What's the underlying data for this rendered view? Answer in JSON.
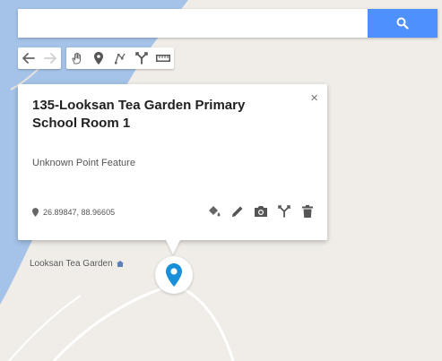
{
  "search": {
    "value": "",
    "placeholder": ""
  },
  "toolbar": {
    "groups": [
      [
        {
          "icon": "undo-icon"
        },
        {
          "icon": "redo-icon"
        }
      ],
      [
        {
          "icon": "hand-icon"
        },
        {
          "icon": "marker-icon"
        },
        {
          "icon": "draw-line-icon"
        },
        {
          "icon": "directions-icon"
        },
        {
          "icon": "ruler-icon"
        }
      ]
    ]
  },
  "info_card": {
    "title": "135-Looksan Tea Garden Primary School Room 1",
    "close": "×",
    "subtitle": "Unknown Point Feature",
    "coordinates": "26.89847, 88.96605",
    "actions": [
      "paint-bucket-icon",
      "pencil-icon",
      "camera-icon",
      "directions-icon",
      "trash-icon"
    ]
  },
  "map": {
    "place_label": "Looksan Tea Garden",
    "colors": {
      "land": "#f0ede8",
      "water": "#a5c3e8",
      "accent": "#4d90fe",
      "marker": "#1a8fd9"
    }
  }
}
